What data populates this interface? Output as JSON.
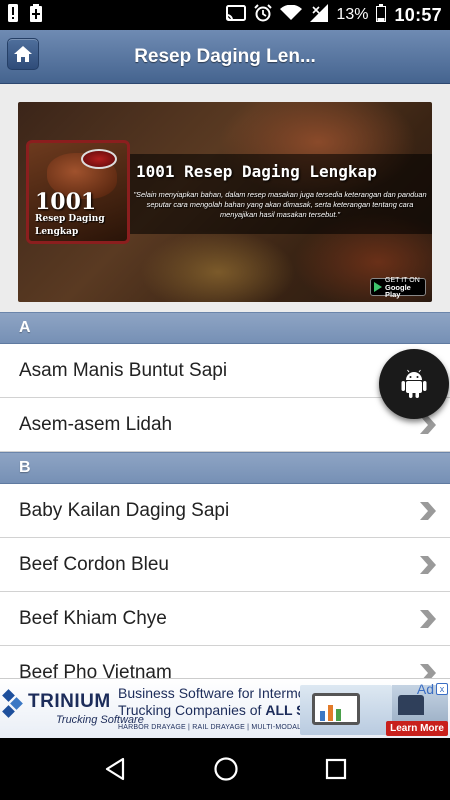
{
  "status_bar": {
    "battery_percent": "13%",
    "time": "10:57",
    "left_icons": [
      "alert-icon",
      "battery-charging-icon"
    ],
    "right_icons": [
      "cast-icon",
      "alarm-icon",
      "wifi-icon",
      "signal-icon",
      "battery-icon"
    ]
  },
  "app_bar": {
    "title": "Resep Daging Len...",
    "home_icon": "home-icon"
  },
  "banner": {
    "card_number": "1001",
    "card_line1": "Resep Daging",
    "card_line2": "Lengkap",
    "title": "1001 Resep Daging Lengkap",
    "quote": "\"Selain menyiapkan bahan, dalam resep masakan juga tersedia keterangan dan panduan seputar cara mengolah bahan yang akan dimasak, serta keterangan tentang cara menyajikan hasil masakan tersebut.\"",
    "store_line1": "GET IT ON",
    "store_line2": "Google Play"
  },
  "sections": [
    {
      "header": "A",
      "items": [
        "Asam Manis Buntut Sapi",
        "Asem-asem Lidah"
      ]
    },
    {
      "header": "B",
      "items": [
        "Baby Kailan Daging Sapi",
        "Beef Cordon Bleu",
        "Beef Khiam Chye",
        "Beef Pho Vietnam"
      ]
    }
  ],
  "fab": {
    "icon": "android-icon"
  },
  "ad": {
    "brand": "TRINIUM",
    "brand_sub": "Trucking Software",
    "line1": "Business Software for Intermodal",
    "line2_prefix": "Trucking Companies of ",
    "line2_bold": "ALL SIZES",
    "line3": "HARBOR DRAYAGE | RAIL DRAYAGE | MULTI-MODAL TRUCKING",
    "ad_label": "Ad",
    "close_label": "x",
    "cta": "Learn More"
  },
  "nav_bar": {
    "icons": [
      "back-icon",
      "home-icon",
      "recents-icon"
    ]
  }
}
